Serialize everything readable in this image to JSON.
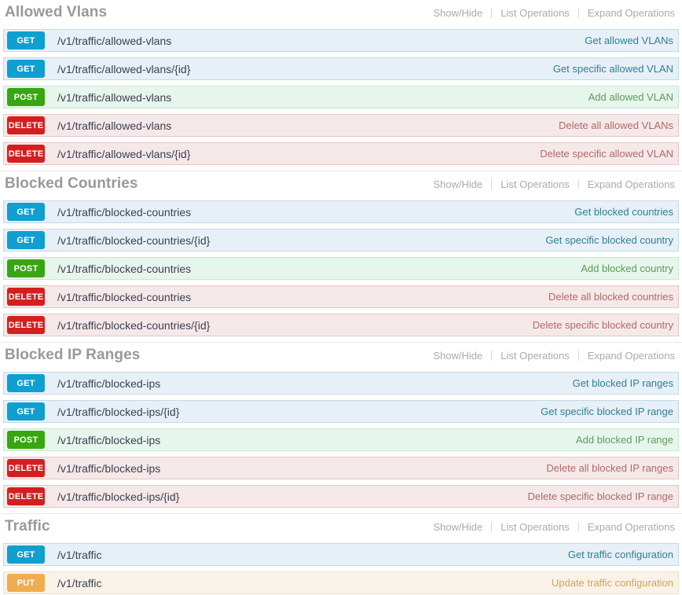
{
  "page": {
    "options_labels": {
      "show_hide": "Show/Hide",
      "list_operations": "List Operations",
      "expand_operations": "Expand Operations"
    }
  },
  "resources": [
    {
      "title": "Allowed Vlans",
      "operations": [
        {
          "method": "GET",
          "path": "/v1/traffic/allowed-vlans",
          "summary": "Get allowed VLANs"
        },
        {
          "method": "GET",
          "path": "/v1/traffic/allowed-vlans/{id}",
          "summary": "Get specific allowed VLAN"
        },
        {
          "method": "POST",
          "path": "/v1/traffic/allowed-vlans",
          "summary": "Add allowed VLAN"
        },
        {
          "method": "DELETE",
          "path": "/v1/traffic/allowed-vlans",
          "summary": "Delete all allowed VLANs"
        },
        {
          "method": "DELETE",
          "path": "/v1/traffic/allowed-vlans/{id}",
          "summary": "Delete specific allowed VLAN"
        }
      ]
    },
    {
      "title": "Blocked Countries",
      "operations": [
        {
          "method": "GET",
          "path": "/v1/traffic/blocked-countries",
          "summary": "Get blocked countries"
        },
        {
          "method": "GET",
          "path": "/v1/traffic/blocked-countries/{id}",
          "summary": "Get specific blocked country"
        },
        {
          "method": "POST",
          "path": "/v1/traffic/blocked-countries",
          "summary": "Add blocked country"
        },
        {
          "method": "DELETE",
          "path": "/v1/traffic/blocked-countries",
          "summary": "Delete all blocked countries"
        },
        {
          "method": "DELETE",
          "path": "/v1/traffic/blocked-countries/{id}",
          "summary": "Delete specific blocked country"
        }
      ]
    },
    {
      "title": "Blocked IP Ranges",
      "operations": [
        {
          "method": "GET",
          "path": "/v1/traffic/blocked-ips",
          "summary": "Get blocked IP ranges"
        },
        {
          "method": "GET",
          "path": "/v1/traffic/blocked-ips/{id}",
          "summary": "Get specific blocked IP range"
        },
        {
          "method": "POST",
          "path": "/v1/traffic/blocked-ips",
          "summary": "Add blocked IP range"
        },
        {
          "method": "DELETE",
          "path": "/v1/traffic/blocked-ips",
          "summary": "Delete all blocked IP ranges"
        },
        {
          "method": "DELETE",
          "path": "/v1/traffic/blocked-ips/{id}",
          "summary": "Delete specific blocked IP range"
        }
      ]
    },
    {
      "title": "Traffic",
      "operations": [
        {
          "method": "GET",
          "path": "/v1/traffic",
          "summary": "Get traffic configuration"
        },
        {
          "method": "PUT",
          "path": "/v1/traffic",
          "summary": "Update traffic configuration"
        }
      ]
    }
  ],
  "colors": {
    "get": "#0f9fd0",
    "post": "#38a611",
    "delete": "#d41f1f",
    "put": "#f0ad4e",
    "heading": "#999999",
    "path_text": "#3b4151"
  }
}
